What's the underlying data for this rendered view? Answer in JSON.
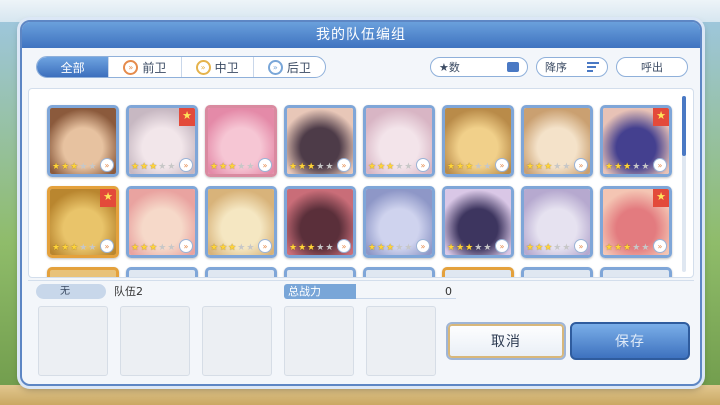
{
  "dialog": {
    "title": "我的队伍编组"
  },
  "filters": {
    "tabs": [
      {
        "label": "全部",
        "active": true,
        "icon": null
      },
      {
        "label": "前卫",
        "active": false,
        "icon": "front-role-icon"
      },
      {
        "label": "中卫",
        "active": false,
        "icon": "mid-role-icon"
      },
      {
        "label": "后卫",
        "active": false,
        "icon": "back-role-icon"
      }
    ],
    "sort_field_label": "★数",
    "sort_order_label": "降序",
    "call_label": "呼出"
  },
  "roster": {
    "cards": [
      {
        "stars": 3,
        "frame": "blue",
        "favorite": false,
        "colors": [
          "#e7c2a0",
          "#8b5a3c"
        ]
      },
      {
        "stars": 3,
        "frame": "blue",
        "favorite": true,
        "colors": [
          "#f2e6ea",
          "#c7b8c2"
        ]
      },
      {
        "stars": 3,
        "frame": "pink",
        "favorite": false,
        "colors": [
          "#f6c6d4",
          "#e48aa8"
        ]
      },
      {
        "stars": 3,
        "frame": "blue",
        "favorite": false,
        "colors": [
          "#4d3b48",
          "#e8c7b8"
        ]
      },
      {
        "stars": 3,
        "frame": "blue",
        "favorite": false,
        "colors": [
          "#f3e4ea",
          "#d8b5c4"
        ]
      },
      {
        "stars": 3,
        "frame": "blue",
        "favorite": false,
        "colors": [
          "#f1d08a",
          "#b98b49"
        ]
      },
      {
        "stars": 3,
        "frame": "blue",
        "favorite": false,
        "colors": [
          "#f4e2c9",
          "#caa071"
        ]
      },
      {
        "stars": 3,
        "frame": "blue",
        "favorite": true,
        "colors": [
          "#44408f",
          "#e8c2b6"
        ]
      },
      {
        "stars": 3,
        "frame": "gold",
        "favorite": true,
        "colors": [
          "#e9c46a",
          "#b9862f"
        ]
      },
      {
        "stars": 3,
        "frame": "blue",
        "favorite": false,
        "colors": [
          "#f6d9c9",
          "#e9a3a0"
        ]
      },
      {
        "stars": 3,
        "frame": "blue",
        "favorite": false,
        "colors": [
          "#f5e7c2",
          "#d8b37a"
        ]
      },
      {
        "stars": 3,
        "frame": "blue",
        "favorite": false,
        "colors": [
          "#5a2f3a",
          "#c96d78"
        ]
      },
      {
        "stars": 3,
        "frame": "blue",
        "favorite": false,
        "colors": [
          "#cfd3ee",
          "#8e97c7"
        ]
      },
      {
        "stars": 3,
        "frame": "blue",
        "favorite": false,
        "colors": [
          "#3d355f",
          "#d9c7e6"
        ]
      },
      {
        "stars": 3,
        "frame": "blue",
        "favorite": false,
        "colors": [
          "#e6e2f0",
          "#b6a9cf"
        ]
      },
      {
        "stars": 3,
        "frame": "blue",
        "favorite": true,
        "colors": [
          "#e37b7f",
          "#f4c5b3"
        ]
      }
    ]
  },
  "team": {
    "none_label": "无",
    "name": "队伍2",
    "power_label": "总战力",
    "power_value": "0"
  },
  "actions": {
    "cancel_label": "取消",
    "save_label": "保存"
  },
  "colors": {
    "accent": "#3f73c0",
    "title_bar": "#4f86cf",
    "favorite_badge": "#e34a3a",
    "star": "#ffd43a"
  }
}
